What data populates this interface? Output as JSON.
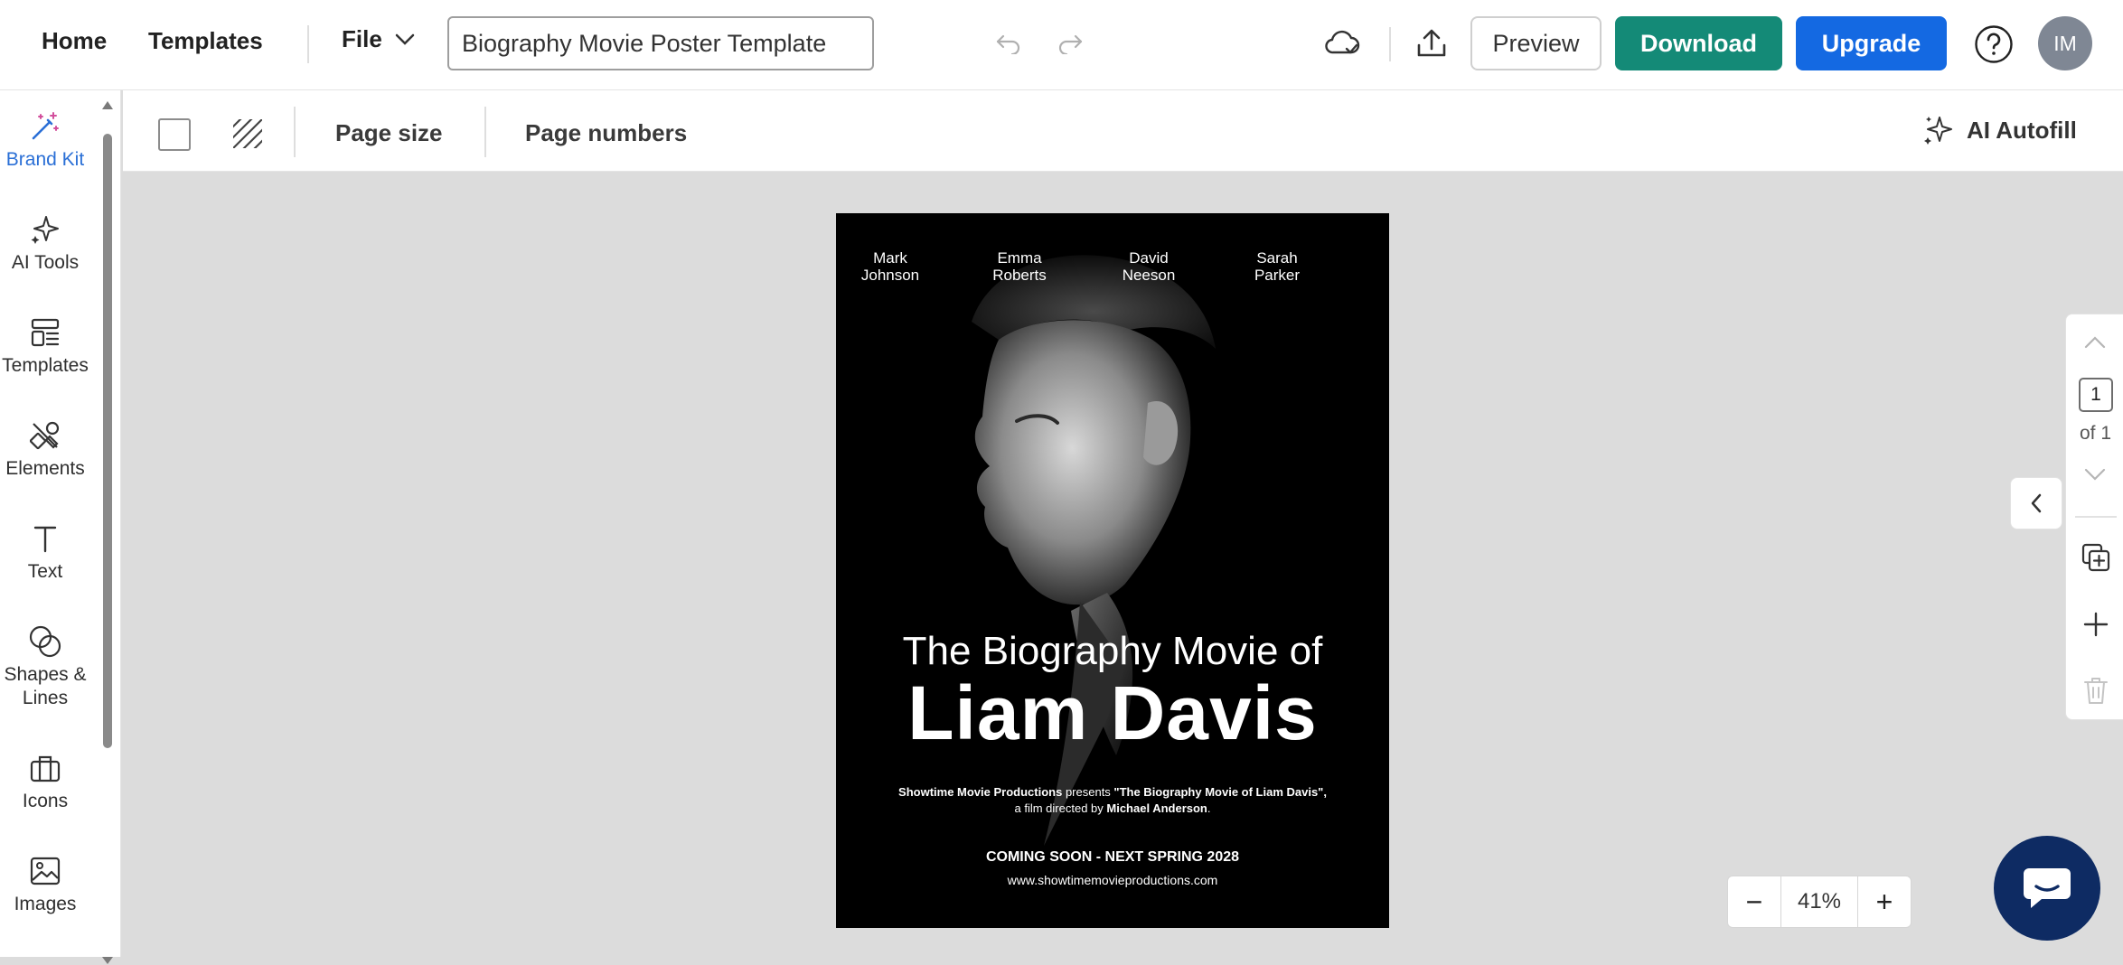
{
  "header": {
    "nav": {
      "home": "Home",
      "templates": "Templates",
      "file": "File"
    },
    "document_title": "Biography Movie Poster Template",
    "buttons": {
      "preview": "Preview",
      "download": "Download",
      "upgrade": "Upgrade"
    },
    "avatar_initials": "IM",
    "icons": [
      "undo-icon",
      "redo-icon",
      "cloud-saved-icon",
      "upload-icon",
      "help-icon",
      "chevron-down-icon"
    ]
  },
  "sidebar": {
    "items": [
      {
        "label": "Brand Kit",
        "icon": "magic-wand-icon",
        "active": true
      },
      {
        "label": "AI Tools",
        "icon": "sparkles-icon"
      },
      {
        "label": "Templates",
        "icon": "templates-icon"
      },
      {
        "label": "Elements",
        "icon": "elements-icon"
      },
      {
        "label": "Text",
        "icon": "text-icon"
      },
      {
        "label": "Shapes & Lines",
        "icon": "shapes-icon"
      },
      {
        "label": "Icons",
        "icon": "briefcase-icon"
      },
      {
        "label": "Images",
        "icon": "image-icon"
      }
    ]
  },
  "toolbar": {
    "page_size": "Page size",
    "page_numbers": "Page numbers",
    "ai_autofill": "AI Autofill"
  },
  "poster": {
    "cast": [
      {
        "first": "Mark",
        "last": "Johnson"
      },
      {
        "first": "Emma",
        "last": "Roberts"
      },
      {
        "first": "David",
        "last": "Neeson"
      },
      {
        "first": "Sarah",
        "last": "Parker"
      }
    ],
    "pre_title": "The Biography Movie of",
    "title": "Liam Davis",
    "credit_studio": "Showtime Movie Productions",
    "credit_presents": " presents ",
    "credit_film": "\"The Biography Movie of Liam Davis\",",
    "credit_directed": "a film directed by ",
    "credit_director": "Michael Anderson",
    "credit_end": ".",
    "coming_soon": "COMING SOON - NEXT SPRING 2028",
    "url": "www.showtimemovieproductions.com"
  },
  "pages": {
    "current": "1",
    "of_label": "of 1"
  },
  "zoom": {
    "minus": "−",
    "value": "41%",
    "plus": "+"
  },
  "colors": {
    "download": "#148a77",
    "upgrade": "#1469e2",
    "brand_active": "#2a6fd6",
    "chat": "#0e2b63",
    "canvas_bg": "#dcdcdc"
  }
}
